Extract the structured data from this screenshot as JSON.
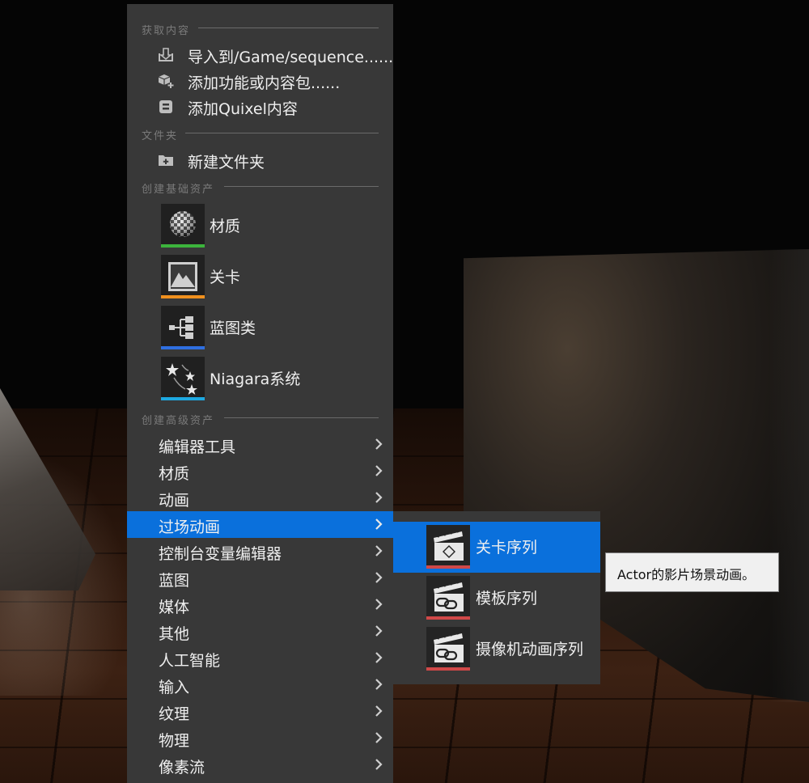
{
  "menu": {
    "sections": {
      "get_content": "获取内容",
      "folder": "文件夹",
      "basic_assets": "创建基础资产",
      "advanced_assets": "创建高级资产"
    },
    "get_content_items": [
      {
        "label": "导入到/Game/sequence......",
        "icon": "import-icon"
      },
      {
        "label": "添加功能或内容包......",
        "icon": "add-feature-pack-icon"
      },
      {
        "label": "添加Quixel内容",
        "icon": "quixel-icon"
      }
    ],
    "folder_items": [
      {
        "label": "新建文件夹",
        "icon": "new-folder-icon"
      }
    ],
    "basic_assets": [
      {
        "label": "材质",
        "icon": "material-sphere-icon",
        "color": "#3cb43c"
      },
      {
        "label": "关卡",
        "icon": "level-mountain-icon",
        "color": "#f0901e"
      },
      {
        "label": "蓝图类",
        "icon": "blueprint-class-icon",
        "color": "#2f6fe0"
      },
      {
        "label": "Niagara系统",
        "icon": "niagara-stars-icon",
        "color": "#1ea8e0"
      }
    ],
    "advanced_categories": [
      {
        "label": "编辑器工具"
      },
      {
        "label": "材质"
      },
      {
        "label": "动画"
      },
      {
        "label": "过场动画",
        "active": true
      },
      {
        "label": "控制台变量编辑器"
      },
      {
        "label": "蓝图"
      },
      {
        "label": "媒体"
      },
      {
        "label": "其他"
      },
      {
        "label": "人工智能"
      },
      {
        "label": "输入"
      },
      {
        "label": "纹理"
      },
      {
        "label": "物理"
      },
      {
        "label": "像素流"
      }
    ]
  },
  "submenu": {
    "items": [
      {
        "label": "关卡序列",
        "icon": "level-sequence-icon",
        "active": true
      },
      {
        "label": "模板序列",
        "icon": "template-sequence-icon"
      },
      {
        "label": "摄像机动画序列",
        "icon": "camera-anim-sequence-icon"
      }
    ]
  },
  "tooltip": {
    "text": "Actor的影片场景动画。"
  },
  "colors": {
    "menu_bg": "#383838",
    "highlight": "#0a70dc",
    "sequence_bar": "#d04848"
  }
}
